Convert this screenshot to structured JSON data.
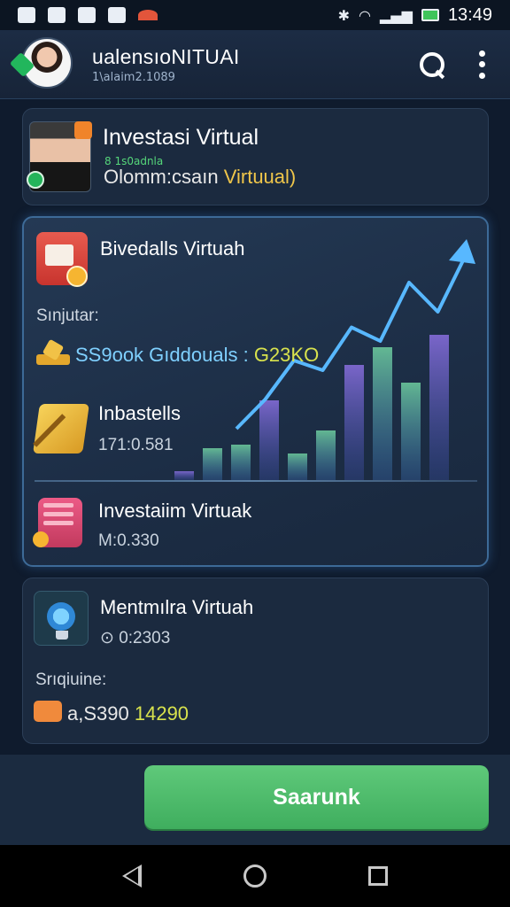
{
  "status_bar": {
    "time": "13:49"
  },
  "header": {
    "title": "ualensıoNITUAI",
    "subtitle": "1\\alaim2.1089"
  },
  "card_top": {
    "title": "Investasi Virtual",
    "tag": "8 1s0adnla",
    "line_prefix": "Olomm:csaın",
    "line_accent": "Virtuual)"
  },
  "card_main": {
    "title": "Bivedalls Virtuah",
    "section_label": "Sınjutar:",
    "money_prefix": "SS9ook Gıddouals :",
    "money_highlight": "G23KO",
    "item1_title": "Inbastells",
    "item1_value": "171:0.581",
    "item2_title": "Investaiim Virtuak",
    "item2_value": "M:0.330",
    "chart_bars": [
      0.05,
      0.18,
      0.2,
      0.45,
      0.15,
      0.28,
      0.65,
      0.75,
      0.55,
      0.82
    ],
    "chart_line": [
      0.1,
      0.25,
      0.45,
      0.4,
      0.62,
      0.55,
      0.85,
      0.7,
      1.0
    ]
  },
  "card_bottom": {
    "title": "Mentmılra Virtuah",
    "value": "⊙ 0:2303",
    "section_label": "Srıqiuine:",
    "money_prefix": "a,S390",
    "money_highlight": "14290"
  },
  "actions": {
    "primary_label": "Saarunk"
  },
  "colors": {
    "accent_green": "#4cbb6c",
    "accent_blue": "#5aa8ff",
    "card_bg": "#1b2a3f"
  }
}
